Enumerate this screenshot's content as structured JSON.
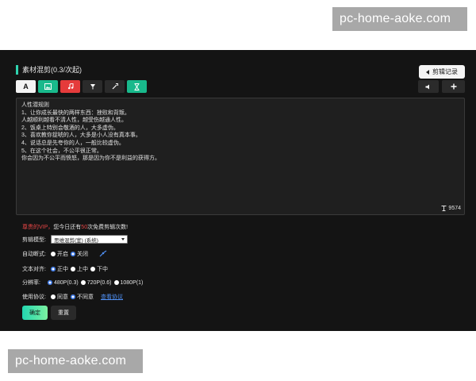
{
  "watermark": {
    "text": "pc-home-aoke.com"
  },
  "header": {
    "title": "素材混剪(0.3/次起)",
    "record_label": "剪辑记录"
  },
  "toolbar": {
    "tools": [
      {
        "name": "text-tool",
        "glyph": "A",
        "bg": "#f4f4f4"
      },
      {
        "name": "image-tool",
        "icon": "image-icon",
        "bg": "#19b98c"
      },
      {
        "name": "music-tool",
        "icon": "music-icon",
        "bg": "#e53b3b"
      },
      {
        "name": "pin-tool",
        "icon": "pin-icon",
        "bg": "#2b2b2b"
      },
      {
        "name": "wand-tool",
        "icon": "wand-icon",
        "bg": "#2b2b2b"
      },
      {
        "name": "hourglass-tool",
        "icon": "hourglass-icon",
        "bg": "#19b98c"
      }
    ],
    "right_tools": [
      {
        "name": "volume-button",
        "icon": "volume-icon"
      },
      {
        "name": "add-button",
        "icon": "plus-icon"
      }
    ]
  },
  "editor": {
    "lines": [
      "人性潜规则",
      "1、让你成长最快的两样东西：挫败和背叛。",
      "人越顺利越看不清人性，越受伤越通人性。",
      "2、饭桌上特别会敬酒的人，大多虚伪。",
      "3、喜欢教你捉唬的人，大多是小人没有真本事。",
      "4、说话总是先夸你的人，一般比较虚伪。",
      "5、在这个社会，不公平很正常。",
      "你会因为不公平而愤怒，那是因为你不是利益的获得方。"
    ],
    "counter": "9574"
  },
  "vip": {
    "prefix": "尊贵的VIP，",
    "middle": "您今日还有",
    "count": "50",
    "suffix": "次免费剪辑次数!"
  },
  "form": {
    "model_label": "剪辑模型:",
    "model_value": "思维混剪(室) (系统)",
    "auto_label": "自动断式:",
    "auto_on": "开启",
    "auto_off": "关闭",
    "align_label": "文本对齐:",
    "align_options": [
      "正中",
      "上中",
      "下中"
    ],
    "resolution_label": "分辨率:",
    "resolution_options": [
      "480P(0.3)",
      "720P(0.6)",
      "1080P(1)"
    ],
    "agreement_label": "使用协议:",
    "agree": "同意",
    "disagree": "不同意",
    "view_agreement": "查看协议"
  },
  "actions": {
    "confirm": "确定",
    "reset": "重置"
  },
  "colors": {
    "accent": "#2fd4b0",
    "danger": "#e64545",
    "link": "#4f8ff2",
    "panel": "#141414"
  }
}
